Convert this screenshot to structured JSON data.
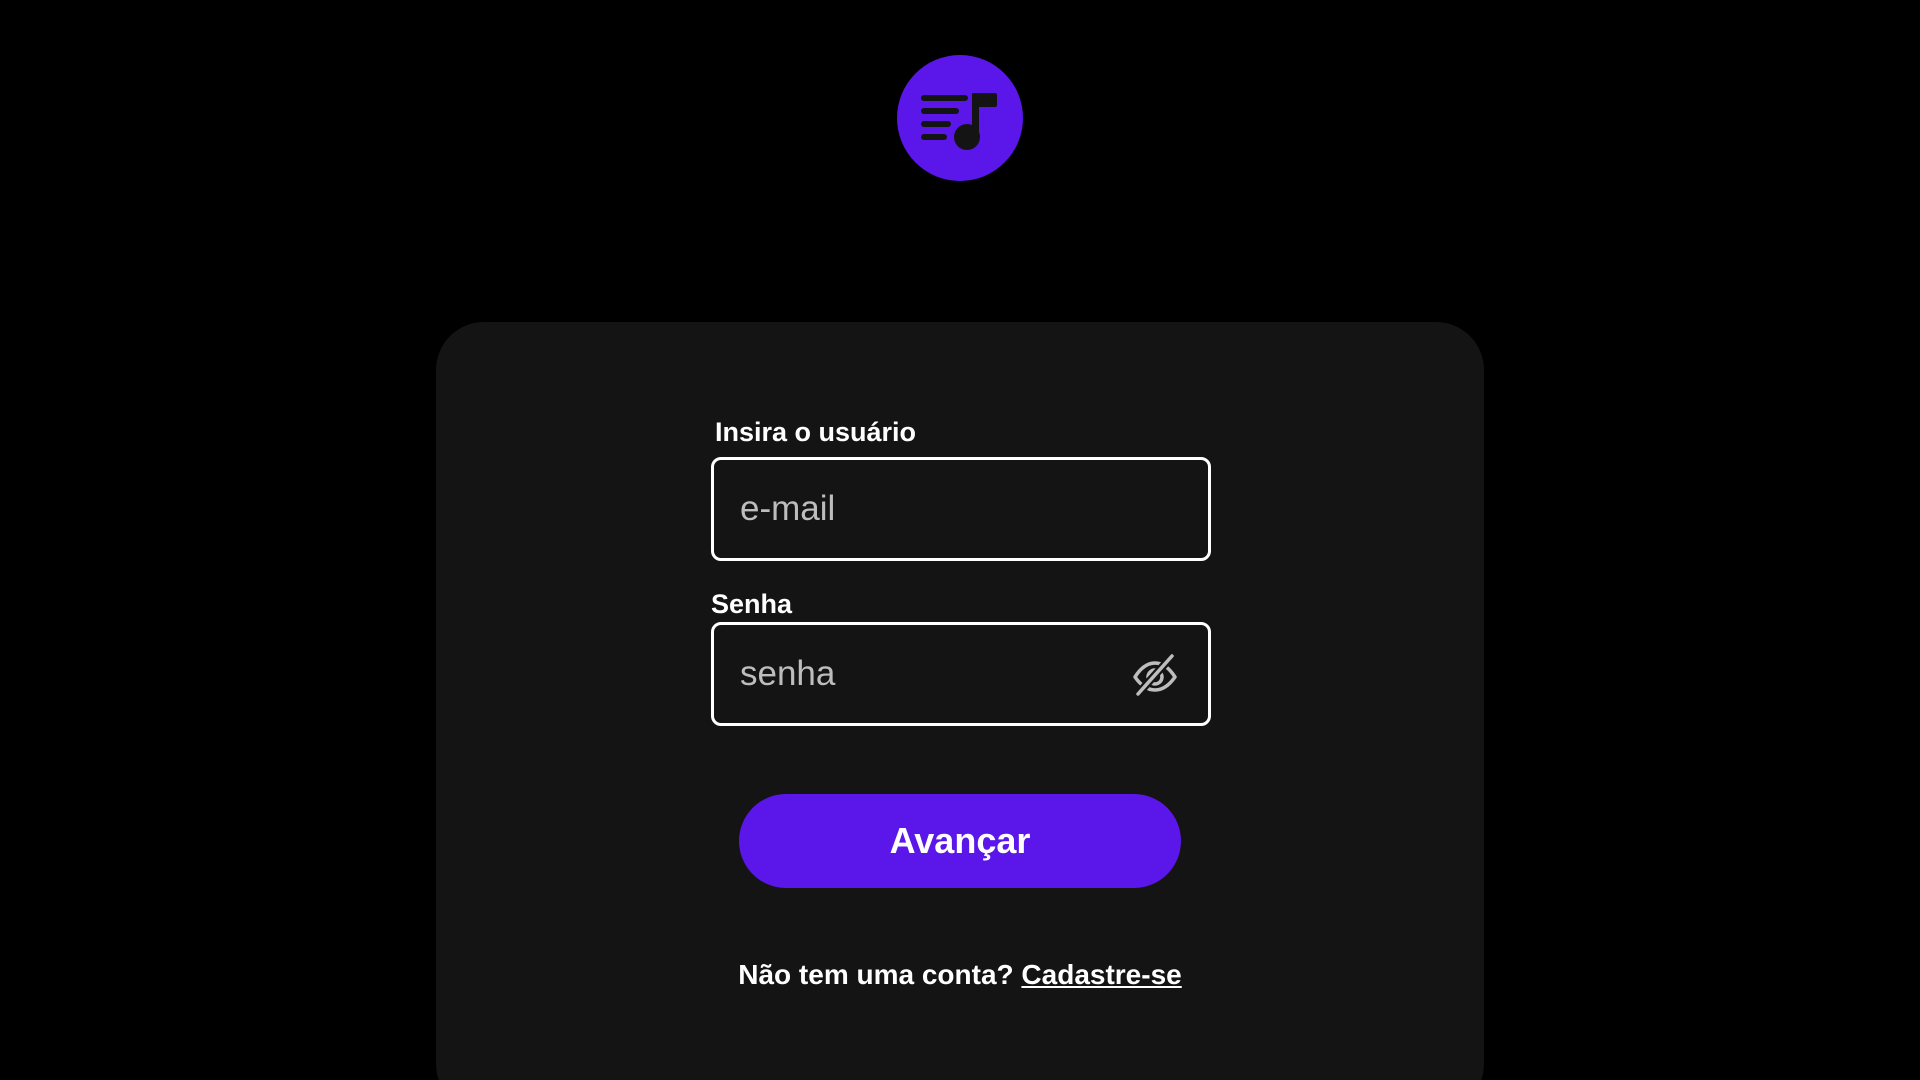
{
  "logo": {
    "icon": "playlist-music-icon",
    "color": "#5b16ea"
  },
  "form": {
    "username": {
      "label": "Insira o usuário",
      "placeholder": "e-mail"
    },
    "password": {
      "label": "Senha",
      "placeholder": "senha",
      "toggle_icon": "eye-off-icon"
    },
    "submit_label": "Avançar"
  },
  "signup": {
    "prompt": "Não tem uma conta?",
    "link": "Cadastre-se"
  },
  "colors": {
    "background": "#000000",
    "card": "#141414",
    "accent": "#5b16ea",
    "text": "#ffffff"
  }
}
